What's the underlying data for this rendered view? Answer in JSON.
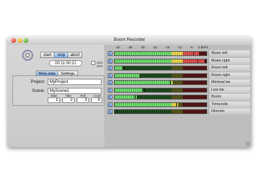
{
  "window": {
    "title": "Boom Recorder"
  },
  "transport": {
    "start_label": "start",
    "stop_label": "stop",
    "abort_label": "abort",
    "time": "00:11:50:21",
    "autostart_label": "auto start",
    "autostart_checked": false,
    "active_button": "stop"
  },
  "tabs": [
    {
      "label": "Meta data",
      "active": true
    },
    {
      "label": "Settings",
      "active": false
    }
  ],
  "metadata": {
    "project_label": "Project:",
    "project_value": "MyProject",
    "scene_label": "Scene:",
    "scene_value": "MyScene1",
    "counters": [
      {
        "label": "Slate",
        "value": "1"
      },
      {
        "label": "Take",
        "value": "2"
      },
      {
        "label": "Roll",
        "value": "3"
      },
      {
        "label": "Count",
        "value": "0"
      }
    ]
  },
  "meters": {
    "scale_labels": [
      "-42",
      "-36",
      "-30",
      "-24",
      "-18",
      "-12",
      "-6",
      "0 dbFS"
    ],
    "channels": [
      {
        "name": "Music left",
        "enabled": true,
        "level": 0.92,
        "peak": 0.86
      },
      {
        "name": "Music right",
        "enabled": true,
        "level": 0.98,
        "peak": 0.9
      },
      {
        "name": "Room left",
        "enabled": true,
        "level": 0.08,
        "peak": 0.1
      },
      {
        "name": "Room right",
        "enabled": true,
        "level": 0.27,
        "peak": 0.27
      },
      {
        "name": "Micheal lav",
        "enabled": true,
        "level": 0.63,
        "peak": 0.6
      },
      {
        "name": "Lisa lav",
        "enabled": true,
        "level": 0.3,
        "peak": 0.32
      },
      {
        "name": "Boom",
        "enabled": true,
        "level": 0.24,
        "peak": 0.22
      },
      {
        "name": "Timecode",
        "enabled": true,
        "level": 0.69,
        "peak": 0.67
      },
      {
        "name": "Director",
        "enabled": true,
        "level": 0.0,
        "peak": 0.02
      }
    ]
  }
}
